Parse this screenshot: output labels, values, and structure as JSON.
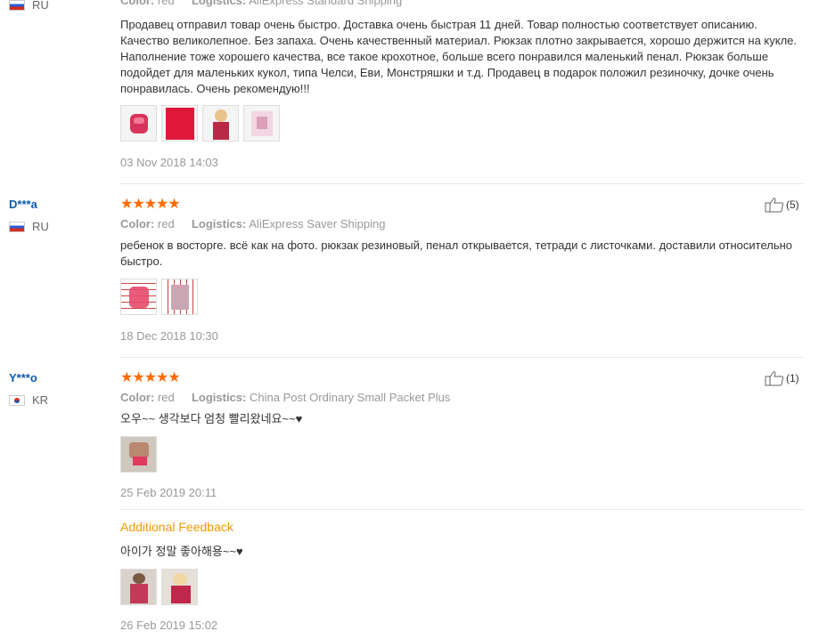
{
  "review1": {
    "country": "RU",
    "color_key": "Color:",
    "color_value": "red",
    "logistics_key": "Logistics:",
    "logistics_value": "AliExpress Standard Shipping",
    "text": "Продавец отправил товар очень быстро. Доставка очень быстрая 11 дней. Товар полностью соответствует описанию. Качество великолепное. Без запаха. Очень качественный материал. Рюкзак плотно закрывается, хорошо держится на кукле. Наполнение тоже хорошего качества, все такое крохотное, больше всего понравился маленький пенал. Рюкзак больше подойдет для маленьких кукол, типа Челси, Еви, Монстряшки и т.д. Продавец в подарок положил резиночку, дочке очень понравилась. Очень рекомендую!!!",
    "date": "03 Nov 2018 14:03"
  },
  "review2": {
    "username": "D***a",
    "country": "RU",
    "stars": "★★★★★",
    "color_key": "Color:",
    "color_value": "red",
    "logistics_key": "Logistics:",
    "logistics_value": "AliExpress Saver Shipping",
    "text": "ребенок в восторге. всё как на фото. рюкзак резиновый, пенал открывается, тетради с листочками. доставили относительно быстро.",
    "date": "18 Dec 2018 10:30",
    "helpful_count": "(5)"
  },
  "review3": {
    "username": "Y***o",
    "country": "KR",
    "stars": "★★★★★",
    "color_key": "Color:",
    "color_value": "red",
    "logistics_key": "Logistics:",
    "logistics_value": "China Post Ordinary Small Packet Plus",
    "text": "오우~~ 생각보다 엄청 빨리왔네요~~♥",
    "date": "25 Feb 2019 20:11",
    "helpful_count": "(1)",
    "additional_label": "Additional Feedback",
    "additional_text": "아이가 정말 좋아해용~~♥",
    "additional_date": "26 Feb 2019 15:02"
  },
  "colors": {
    "username": "#0d5bab",
    "stars": "#ff6a00",
    "additional_feedback": "#f39800",
    "meta": "#999999"
  }
}
